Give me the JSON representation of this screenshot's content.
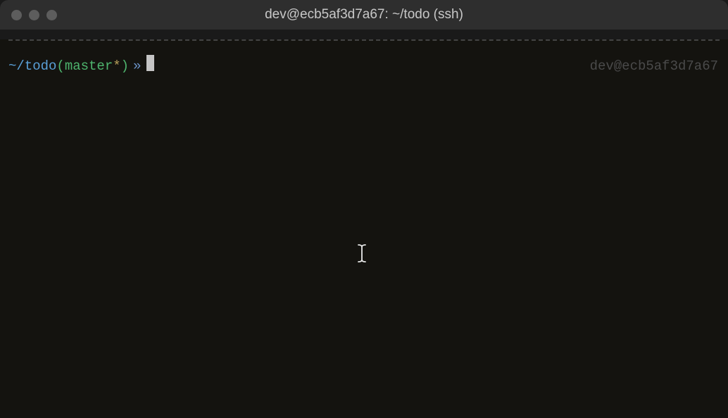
{
  "titlebar": {
    "title": "dev@ecb5af3d7a67: ~/todo (ssh)"
  },
  "prompt": {
    "path": "~/todo",
    "paren_open": "(",
    "branch": "master",
    "star": "*",
    "paren_close": ")",
    "arrow": "»",
    "right_info": "dev@ecb5af3d7a67"
  }
}
